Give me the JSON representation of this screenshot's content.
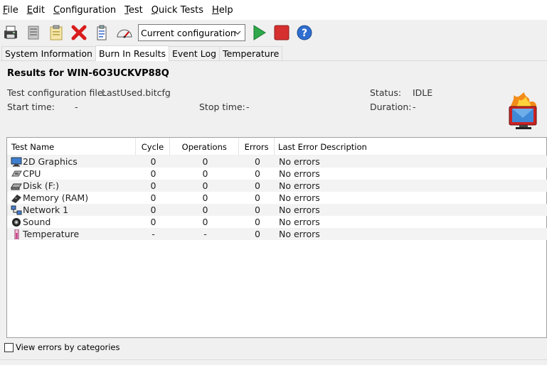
{
  "menu": {
    "items": [
      {
        "u": "F",
        "rest": "ile"
      },
      {
        "u": "E",
        "rest": "dit"
      },
      {
        "u": "C",
        "rest": "onfiguration"
      },
      {
        "u": "T",
        "rest": "est"
      },
      {
        "u": "Q",
        "rest": "uick Tests"
      },
      {
        "u": "H",
        "rest": "elp"
      }
    ]
  },
  "toolbar": {
    "config_value": "Current configuration"
  },
  "tabs": [
    {
      "label": "System Information",
      "active": false
    },
    {
      "label": "Burn In Results",
      "active": true
    },
    {
      "label": "Event Log",
      "active": false
    },
    {
      "label": "Temperature",
      "active": false
    }
  ],
  "results": {
    "title": "Results for WIN-6O3UCKVP88Q",
    "config_file_label": "Test configuration file:",
    "config_file_value": "LastUsed.bitcfg",
    "status_label": "Status:",
    "status_value": "IDLE",
    "start_label": "Start time:",
    "start_value": "-",
    "stop_label": "Stop time:",
    "stop_value": "-",
    "duration_label": "Duration:",
    "duration_value": "-"
  },
  "table": {
    "headers": [
      "Test Name",
      "Cycle",
      "Operations",
      "Errors",
      "Last Error Description"
    ],
    "rows": [
      {
        "icon": "monitor-2d-icon",
        "name": "2D Graphics",
        "cycle": "0",
        "operations": "0",
        "errors": "0",
        "desc": "No errors"
      },
      {
        "icon": "cpu-chip-icon",
        "name": "CPU",
        "cycle": "0",
        "operations": "0",
        "errors": "0",
        "desc": "No errors"
      },
      {
        "icon": "disk-drive-icon",
        "name": "Disk (F:)",
        "cycle": "0",
        "operations": "0",
        "errors": "0",
        "desc": "No errors"
      },
      {
        "icon": "memory-ram-icon",
        "name": "Memory (RAM)",
        "cycle": "0",
        "operations": "0",
        "errors": "0",
        "desc": "No errors"
      },
      {
        "icon": "network-icon",
        "name": "Network 1",
        "cycle": "0",
        "operations": "0",
        "errors": "0",
        "desc": "No errors"
      },
      {
        "icon": "sound-speaker-icon",
        "name": "Sound",
        "cycle": "0",
        "operations": "0",
        "errors": "0",
        "desc": "No errors"
      },
      {
        "icon": "thermometer-icon",
        "name": "Temperature",
        "cycle": "-",
        "operations": "-",
        "errors": "0",
        "desc": "No errors"
      }
    ]
  },
  "footer": {
    "view_errors_label": "View errors by categories"
  },
  "colors": {
    "accent_green": "#2ea84a",
    "stop_red": "#d62f2f",
    "help_blue": "#2f6ed0",
    "delete_red": "#d91c1c"
  }
}
